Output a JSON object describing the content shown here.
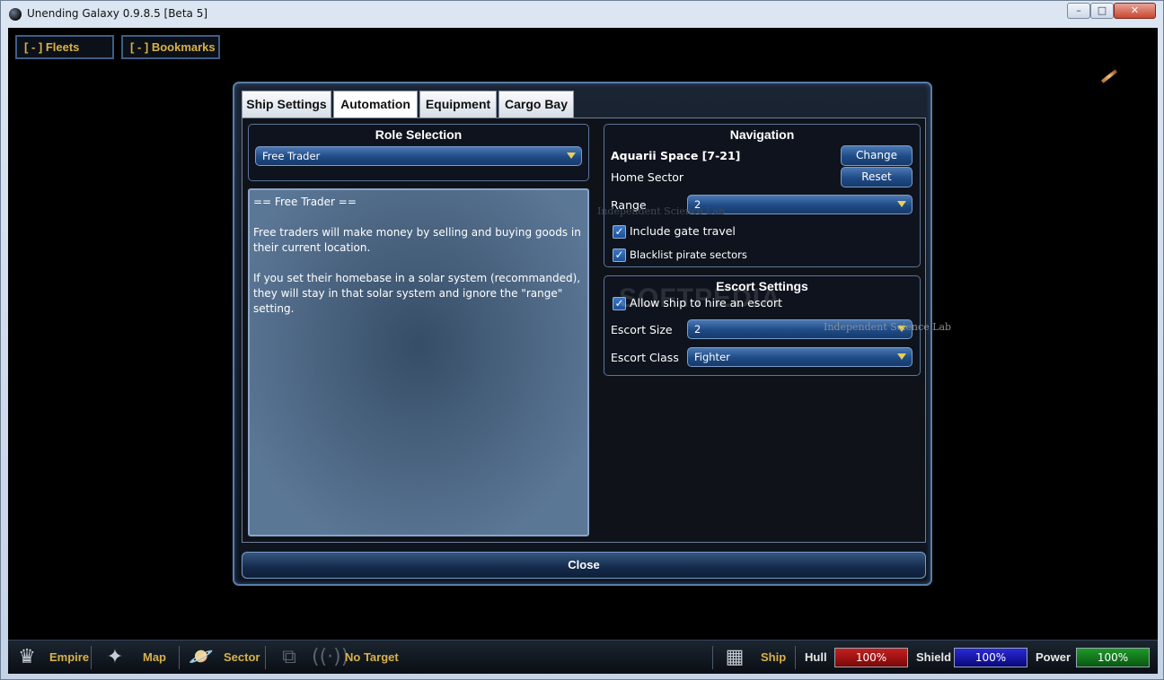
{
  "window": {
    "title": "Unending Galaxy 0.9.8.5 [Beta 5]",
    "minimize": "–",
    "maximize": "□",
    "close": "✕"
  },
  "top_toggles": {
    "fleets": "[ - ] Fleets",
    "bookmarks": "[ - ] Bookmarks"
  },
  "dialog": {
    "tabs": [
      "Ship Settings",
      "Automation",
      "Equipment",
      "Cargo Bay"
    ],
    "active_tab": "Automation",
    "role": {
      "title": "Role Selection",
      "selected": "Free Trader",
      "description_heading": "== Free Trader ==",
      "description_p1": "Free traders will make money by selling and buying goods in their current location.",
      "description_p2": "If you set their homebase in a solar system (recommanded), they will stay in that solar system and ignore the \"range\" setting."
    },
    "navigation": {
      "title": "Navigation",
      "sector": "Aquarii Space [7-21]",
      "home_label": "Home Sector",
      "change": "Change",
      "reset": "Reset",
      "range_label": "Range",
      "range_value": "2",
      "include_gate": "Include gate travel",
      "include_gate_checked": true,
      "blacklist": "Blacklist pirate sectors",
      "blacklist_checked": true
    },
    "escort": {
      "title": "Escort Settings",
      "allow_label": "Allow ship to hire an escort",
      "allow_checked": true,
      "size_label": "Escort Size",
      "size_value": "2",
      "class_label": "Escort Class",
      "class_value": "Fighter"
    },
    "close": "Close"
  },
  "map_labels": {
    "label1": "Independent Science Lab",
    "label2": "Independent Science Lab",
    "watermark": "SOFTPEDIA"
  },
  "bottom_bar": {
    "empire": "Empire",
    "map": "Map",
    "sector": "Sector",
    "target": "No Target",
    "ship": "Ship",
    "hull_label": "Hull",
    "hull_value": "100%",
    "shield_label": "Shield",
    "shield_value": "100%",
    "power_label": "Power",
    "power_value": "100%",
    "colors": {
      "hull": "#c42020",
      "shield": "#2a2ad8",
      "power": "#1e9a2a",
      "gold": "#d7b24a"
    }
  }
}
